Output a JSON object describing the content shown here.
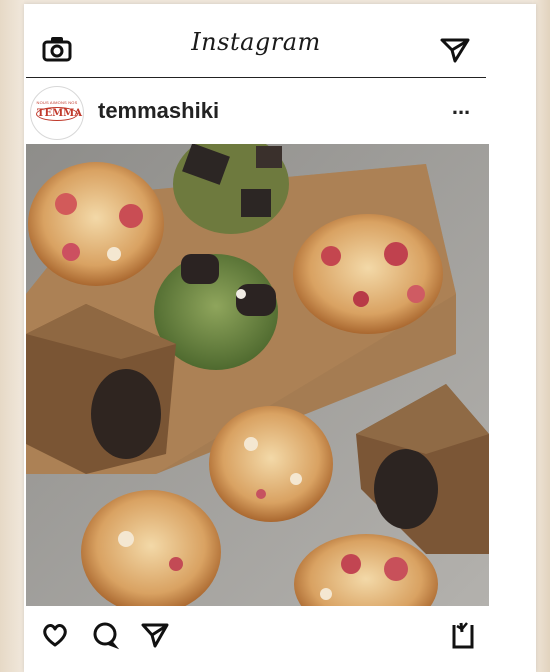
{
  "header": {
    "app_title": "Instagram",
    "left_icon": "camera-icon",
    "right_icon": "send-icon"
  },
  "post": {
    "username": "temmashiki",
    "avatar": {
      "brand": "TEMMA",
      "sub": "NOUS AIMONS NOS"
    },
    "more_icon": "ellipsis-icon",
    "more_label": "..."
  },
  "actions": {
    "icons": [
      "heart-icon",
      "comment-icon",
      "send-icon",
      "bookmark-icon"
    ]
  },
  "colors": {
    "card": "#ffffff",
    "backdrop": "#efe6da",
    "text": "#222222",
    "brand_red": "#c0392b"
  }
}
